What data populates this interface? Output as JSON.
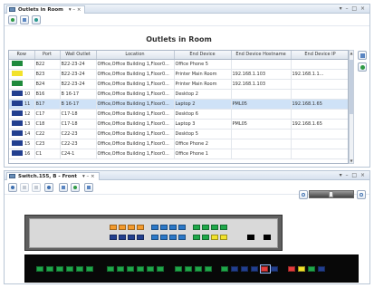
{
  "outlets_panel": {
    "tab_label": "Outlets in Room",
    "tab_controls": "▾ – ×",
    "window_controls": "▾ – □ ×",
    "table_title": "Outlets in Room",
    "columns": [
      "Row",
      "Port",
      "Wall Outlet",
      "Location",
      "End Device",
      "End Device Hostname",
      "End Device IP"
    ],
    "rows": [
      {
        "color": "#1f8a3c",
        "row": "",
        "port": "B22",
        "outlet": "B22-23-24",
        "location": "Office,Office Building 1,Floor0...",
        "device": "Office Phone 5",
        "hostname": "",
        "ip": ""
      },
      {
        "color": "#f2e22b",
        "row": "",
        "port": "B23",
        "outlet": "B22-23-24",
        "location": "Office,Office Building 1,Floor0...",
        "device": "Printer Main Room",
        "hostname": "192.168.1.103",
        "ip": "192.168.1.1..."
      },
      {
        "color": "#1f8a3c",
        "row": "",
        "port": "B24",
        "outlet": "B22-23-24",
        "location": "Office,Office Building 1,Floor0...",
        "device": "Printer Main Room",
        "hostname": "192.168.1.103",
        "ip": ""
      },
      {
        "color": "#223f8f",
        "row": "10",
        "port": "B16",
        "outlet": "B 16-17",
        "location": "Office,Office Building 1,Floor0...",
        "device": "Desktop 2",
        "hostname": "",
        "ip": ""
      },
      {
        "color": "#223f8f",
        "row": "11",
        "port": "B17",
        "outlet": "B 16-17",
        "location": "Office,Office Building 1,Floor0...",
        "device": "Laptop 2",
        "hostname": "PML05",
        "ip": "192.168.1.65",
        "selected": true
      },
      {
        "color": "#223f8f",
        "row": "12",
        "port": "C17",
        "outlet": "C17-18",
        "location": "Office,Office Building 1,Floor0...",
        "device": "Desktop 6",
        "hostname": "",
        "ip": ""
      },
      {
        "color": "#223f8f",
        "row": "13",
        "port": "C18",
        "outlet": "C17-18",
        "location": "Office,Office Building 1,Floor0...",
        "device": "Laptop 3",
        "hostname": "PML05",
        "ip": "192.168.1.65"
      },
      {
        "color": "#223f8f",
        "row": "14",
        "port": "C22",
        "outlet": "C22-23",
        "location": "Office,Office Building 1,Floor0...",
        "device": "Desktop 5",
        "hostname": "",
        "ip": ""
      },
      {
        "color": "#223f8f",
        "row": "15",
        "port": "C23",
        "outlet": "C22-23",
        "location": "Office,Office Building 1,Floor0...",
        "device": "Office Phone 2",
        "hostname": "",
        "ip": ""
      },
      {
        "color": "#223f8f",
        "row": "16",
        "port": "C1",
        "outlet": "C24-1",
        "location": "Office,Office Building 1,Floor0...",
        "device": "Office Phone 1",
        "hostname": "",
        "ip": ""
      }
    ]
  },
  "switch_panel": {
    "tab_label": "Switch.155, B - Front",
    "tab_controls": "▾ – ×",
    "window_controls": "▾ – □ ×",
    "zoom_level": 0.5,
    "top_chassis_ports_row1": [
      "#f39a2c",
      "#f39a2c",
      "#f39a2c",
      "#f39a2c",
      "#2b78c8",
      "#2b78c8",
      "#2b78c8",
      "#2b78c8",
      "#1fa84a",
      "#1fa84a",
      "#1fa84a",
      "#1fa84a"
    ],
    "top_chassis_ports_row2": [
      "#223f8f",
      "#223f8f",
      "#223f8f",
      "#223f8f",
      "#2b78c8",
      "#2b78c8",
      "#2b78c8",
      "#2b78c8",
      "#1fa84a",
      "#1fa84a",
      "#f2e22b",
      "#f2e22b"
    ],
    "bottom_chassis_ports": [
      "#1fa84a",
      "#1fa84a",
      "#1fa84a",
      "#1fa84a",
      "#1fa84a",
      "#1fa84a",
      "#1fa84a",
      "#1fa84a",
      "#1fa84a",
      "#1fa84a",
      "#1fa84a",
      "#1fa84a",
      "#1fa84a",
      "#1fa84a",
      "#1fa84a",
      "#1fa84a",
      "#1fa84a",
      "#223f8f",
      "#223f8f",
      "#223f8f",
      "#e43c3c",
      "#223f8f",
      "#e43c3c",
      "#f2e22b",
      "#1fa84a",
      "#223f8f"
    ]
  }
}
